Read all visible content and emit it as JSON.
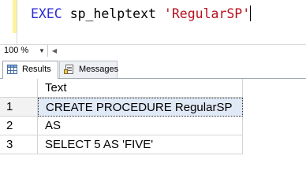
{
  "editor": {
    "keyword": "EXEC",
    "procedure": "sp_helptext",
    "argument": "'RegularSP'"
  },
  "zoom": {
    "value": "100 %",
    "arrow_icon": "dropdown-triangle",
    "scroll_left_icon": "scroll-left-arrow"
  },
  "tabs": [
    {
      "label": "Results",
      "icon": "grid-icon",
      "active": true
    },
    {
      "label": "Messages",
      "icon": "messages-icon",
      "active": false
    }
  ],
  "grid": {
    "column_header": "Text",
    "rows": [
      {
        "num": "1",
        "text": "CREATE PROCEDURE RegularSP"
      },
      {
        "num": "2",
        "text": "AS"
      },
      {
        "num": "3",
        "text": "SELECT 5 AS 'FIVE'"
      }
    ]
  },
  "colors": {
    "keyword": "#2b2bd6",
    "string": "#b80f1b",
    "selected_cell": "#e0e9f6",
    "change_bar": "#fff299"
  }
}
